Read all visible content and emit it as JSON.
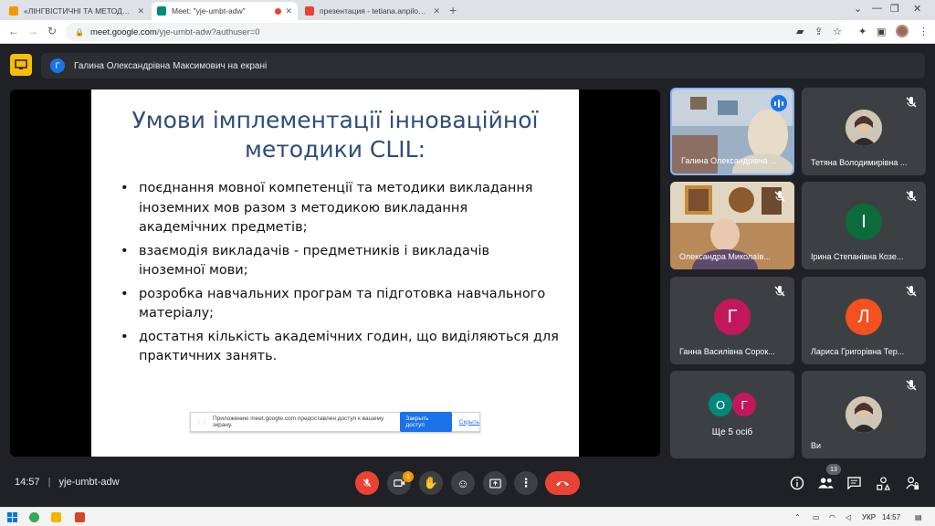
{
  "browser": {
    "tabs": [
      {
        "title": "«ЛІНГВІСТИЧНІ ТА МЕТОДОЛОГ",
        "favicon_color": "#f29900"
      },
      {
        "title": "Meet: \"yje-umbt-adw\"",
        "favicon_color": "#00897b"
      },
      {
        "title": "презентация - tetiana.anpilohova",
        "favicon_color": "#ea4335"
      }
    ],
    "url_host": "meet.google.com",
    "url_path": "/yje-umbt-adw?authuser=0"
  },
  "meet": {
    "presenter_initial": "Г",
    "presenter_text": "Галина Олександрівна Максимович на екрані",
    "meeting_code": "yje-umbt-adw",
    "time": "14:57",
    "activity_badge": "1",
    "participant_count": "13"
  },
  "slide": {
    "title_line1": "Умови імплементації інноваційної",
    "title_line2": "методики CLIL:",
    "bullets": [
      {
        "line1": "поєднання мовної компетенції та методики викладання",
        "line2": "іноземних мов разом з методикою викладання",
        "line3": "академічних предметів;"
      },
      {
        "line1": "взаємодія викладачів - предметників і викладачів",
        "line2": "іноземної мови;",
        "line3": ""
      },
      {
        "line1": "розробка навчальних програм та підготовка навчального",
        "line2": "матеріалу;",
        "line3": ""
      },
      {
        "line1": "достатня кількість академічних годин, що виділяються для",
        "line2": "практичних занять.",
        "line3": ""
      }
    ],
    "share_notice": "Приложению meet.google.com предоставлен доступ к вашему экрану.",
    "share_stop": "Закрыть доступ",
    "share_hide": "Скрыть"
  },
  "participants": [
    {
      "name": "Галина Олександрівна ...",
      "type": "video"
    },
    {
      "name": "Тетяна Володимирівна ...",
      "type": "photo"
    },
    {
      "name": "Олександра Миколаїв...",
      "type": "video"
    },
    {
      "name": "Ірина Степанівна Козе...",
      "initial": "І",
      "color": "#0b6b3a"
    },
    {
      "name": "Ганна Василівна Сорок...",
      "initial": "Г",
      "color": "#c2185b"
    },
    {
      "name": "Лариса Григорівна Тер...",
      "initial": "Л",
      "color": "#f4511e"
    },
    {
      "name": "Ще 5 осіб",
      "initials": [
        "О",
        "Г"
      ],
      "colors": [
        "#00897b",
        "#c2185b"
      ]
    },
    {
      "name": "Ви",
      "type": "photo"
    }
  ],
  "taskbar": {
    "language": "УКР",
    "time": "14:57"
  }
}
